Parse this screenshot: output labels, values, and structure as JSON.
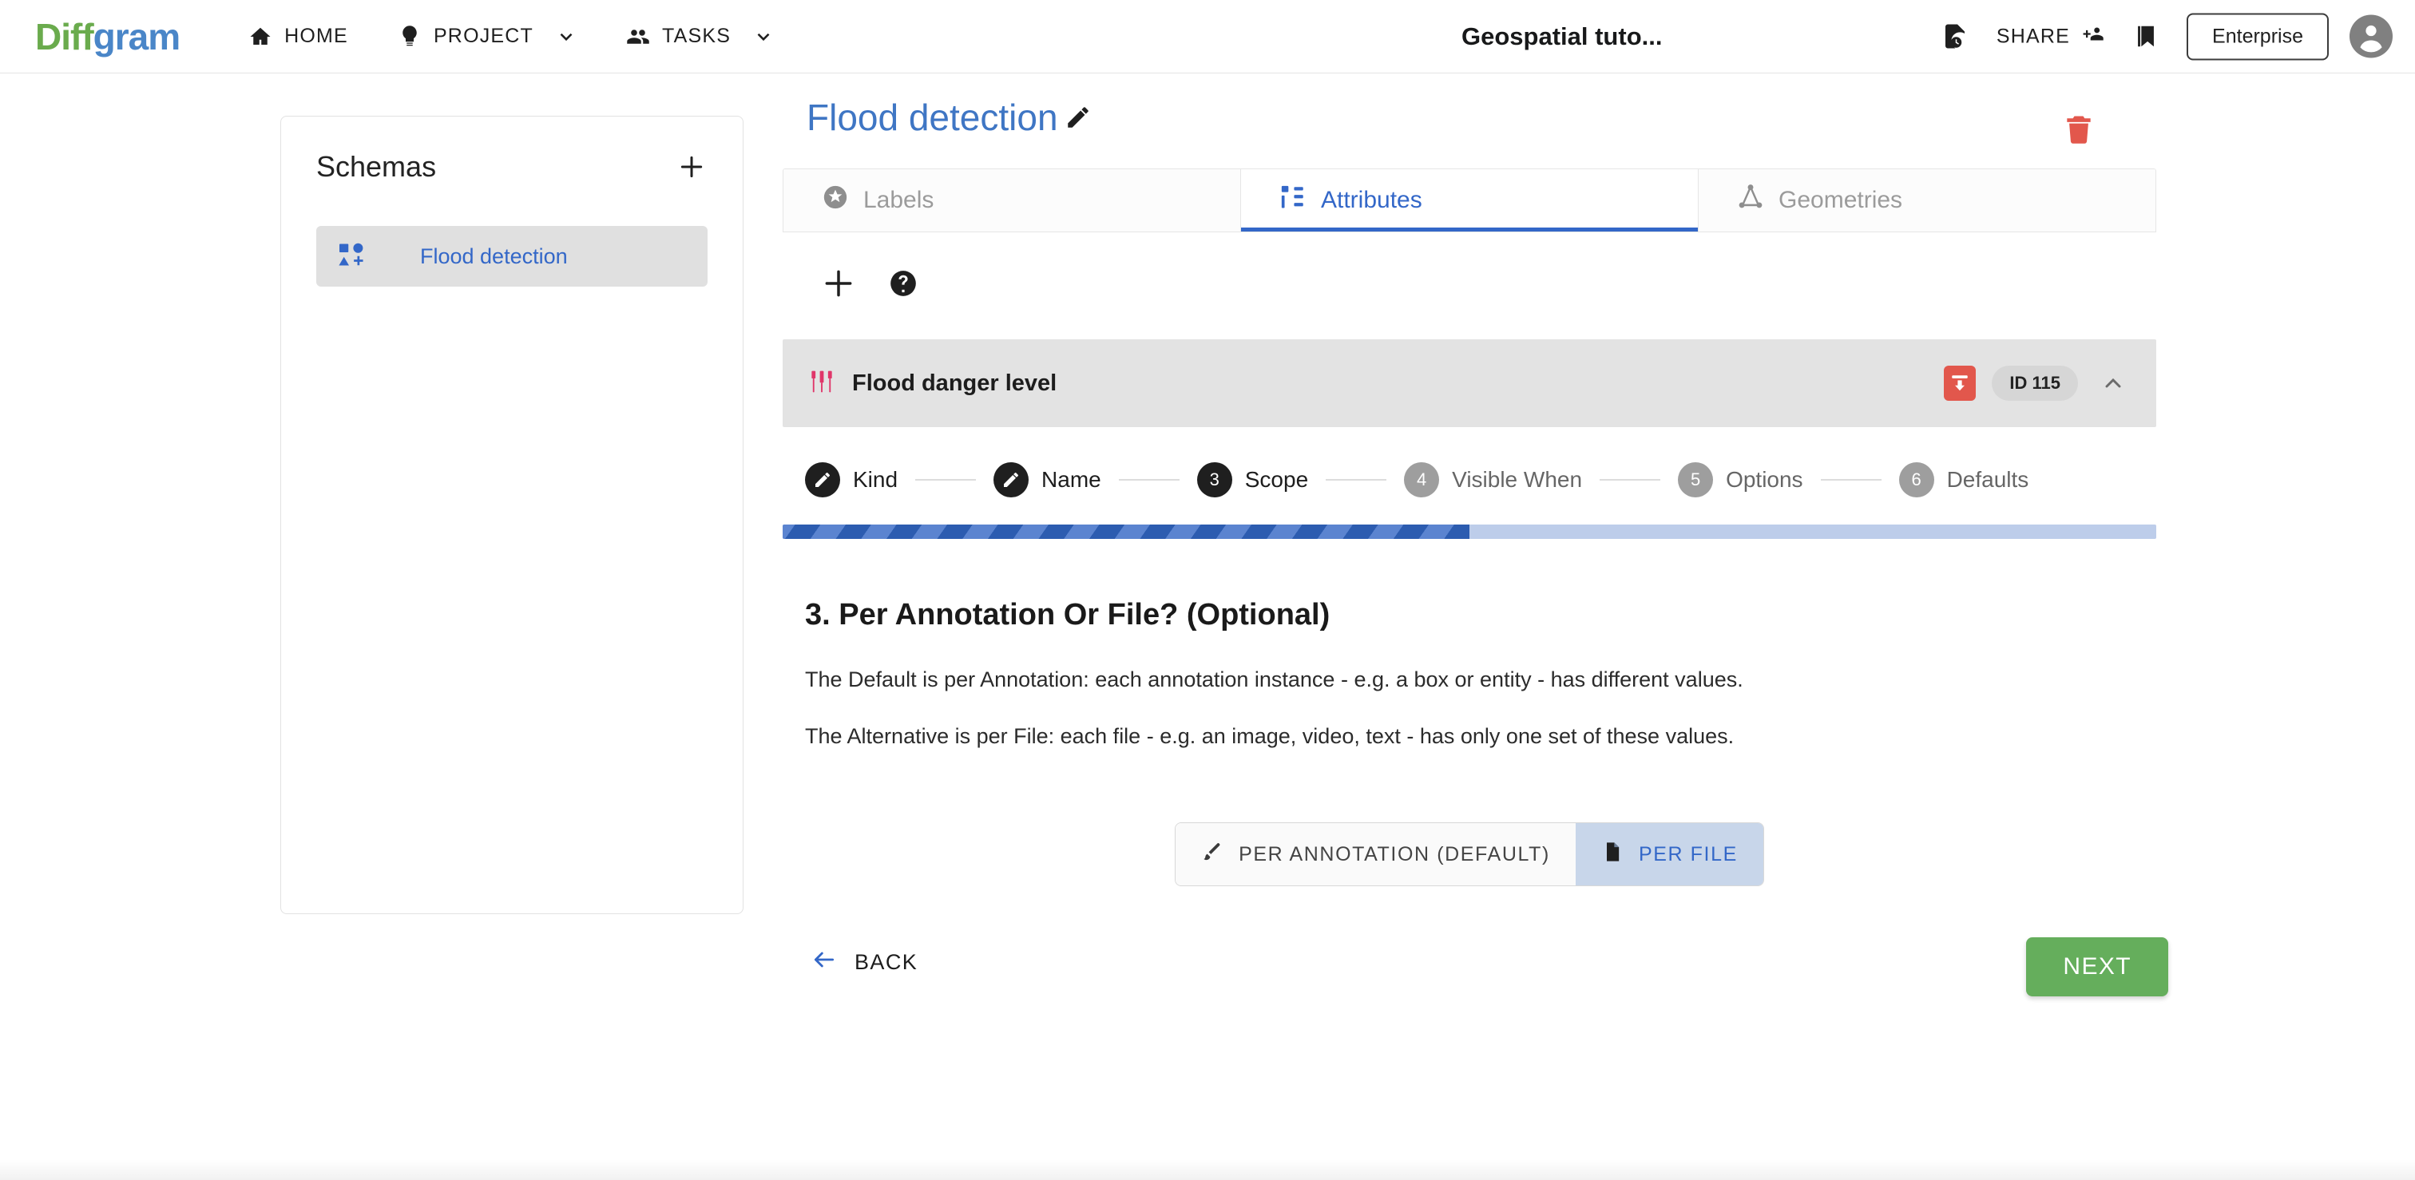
{
  "topbar": {
    "logo_part1": "Diff",
    "logo_part2": "gram",
    "nav": [
      {
        "label": "HOME",
        "icon": "home-icon",
        "has_chevron": false
      },
      {
        "label": "PROJECT",
        "icon": "bulb-icon",
        "has_chevron": true
      },
      {
        "label": "TASKS",
        "icon": "people-icon",
        "has_chevron": true
      }
    ],
    "project_title": "Geospatial tuto...",
    "history_icon": "file-clock-icon",
    "share_label": "SHARE",
    "share_icon": "person-add-icon",
    "bookmark_icon": "bookmark-icon",
    "enterprise_label": "Enterprise",
    "avatar_icon": "account-circle-icon"
  },
  "sidebar": {
    "title": "Schemas",
    "add_icon": "plus-icon",
    "items": [
      {
        "label": "Flood detection",
        "icon": "shapes-add-icon",
        "selected": true
      }
    ]
  },
  "main": {
    "page_title": "Flood detection",
    "edit_icon": "pencil-icon",
    "delete_icon": "trash-icon",
    "tabs": [
      {
        "label": "Labels",
        "icon": "star-icon",
        "active": false
      },
      {
        "label": "Attributes",
        "icon": "attribute-tree-icon",
        "active": true
      },
      {
        "label": "Geometries",
        "icon": "geometry-icon",
        "active": false
      }
    ],
    "actions": [
      {
        "name": "add-attribute",
        "icon": "plus-icon"
      },
      {
        "name": "help",
        "icon": "help-icon"
      }
    ],
    "group": {
      "name": "Flood danger level",
      "icon": "tune-sliders-icon",
      "archive_icon": "archive-icon",
      "id_badge": "ID 115",
      "collapse_icon": "chevron-up-icon"
    },
    "stepper": {
      "steps": [
        {
          "num": "1",
          "label": "Kind",
          "state": "done"
        },
        {
          "num": "2",
          "label": "Name",
          "state": "done"
        },
        {
          "num": "3",
          "label": "Scope",
          "state": "active"
        },
        {
          "num": "4",
          "label": "Visible When",
          "state": "todo"
        },
        {
          "num": "5",
          "label": "Options",
          "state": "todo"
        },
        {
          "num": "6",
          "label": "Defaults",
          "state": "todo"
        }
      ],
      "progress_percent": 50
    },
    "section_title": "3. Per Annotation Or File? (Optional)",
    "paragraph_1": "The Default is per Annotation: each annotation instance - e.g. a box or entity - has different values.",
    "paragraph_2": "The Alternative is per File: each file - e.g. an image, video, text - has only one set of these values.",
    "scope_toggle": [
      {
        "label": "PER ANNOTATION (DEFAULT)",
        "icon": "brush-icon",
        "selected": false
      },
      {
        "label": "PER FILE",
        "icon": "file-icon",
        "selected": true
      }
    ],
    "back_label": "BACK",
    "back_icon": "arrow-left-icon",
    "next_label": "NEXT"
  },
  "colors": {
    "brand_green": "#6aab4d",
    "brand_blue": "#4a86c8",
    "link_blue": "#3367c8",
    "danger_red": "#e2574c",
    "accent_pink": "#e0366a",
    "next_green": "#65ae5c"
  }
}
